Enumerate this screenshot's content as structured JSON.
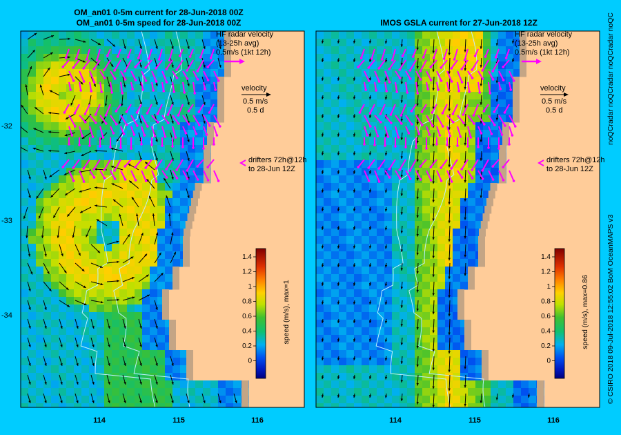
{
  "left_panel": {
    "title_line1": "OM_an01 0-5m current for 28-Jun-2018 00Z",
    "title_line2": "OM_an01 0-5m speed for 28-Jun-2018 00Z",
    "colorbar_label": "speed (m/s), max=1"
  },
  "right_panel": {
    "title": "IMOS GSLA current for 27-Jun-2018 12Z",
    "colorbar_label": "speed (m/s), max=0.86"
  },
  "legend": {
    "hf_line1": "HF radar velocity",
    "hf_line2": "(13-25h avg)",
    "hf_line3": "0.5m/s (1kt 12h)",
    "vel_line1": "velocity",
    "vel_line2": "0.5 m/s",
    "vel_line3": "0.5 d",
    "drift_line1": "drifters 72h@12h",
    "drift_line2": "to 28-Jun 12Z"
  },
  "axes": {
    "lat_ticks": [
      "-32",
      "-33",
      "-34"
    ],
    "lon_ticks": [
      "114",
      "115",
      "116"
    ],
    "colorbar_ticks": [
      "1.4",
      "1.2",
      "1",
      "0.8",
      "0.6",
      "0.4",
      "0.2",
      "0"
    ]
  },
  "credit": "© CSIRO 2018   09-Jul-2018 12:55:02 BoM OceanMAPS v3",
  "side_marquee": "noQCradar noQCradar noQCradar noQC",
  "colors": {
    "background": "#00ccff",
    "land": "#ffcc99",
    "shelf": "#c4a585",
    "hf_radar": "#ff00ff",
    "drifter": "#ffffff",
    "vector": "#000000"
  }
}
